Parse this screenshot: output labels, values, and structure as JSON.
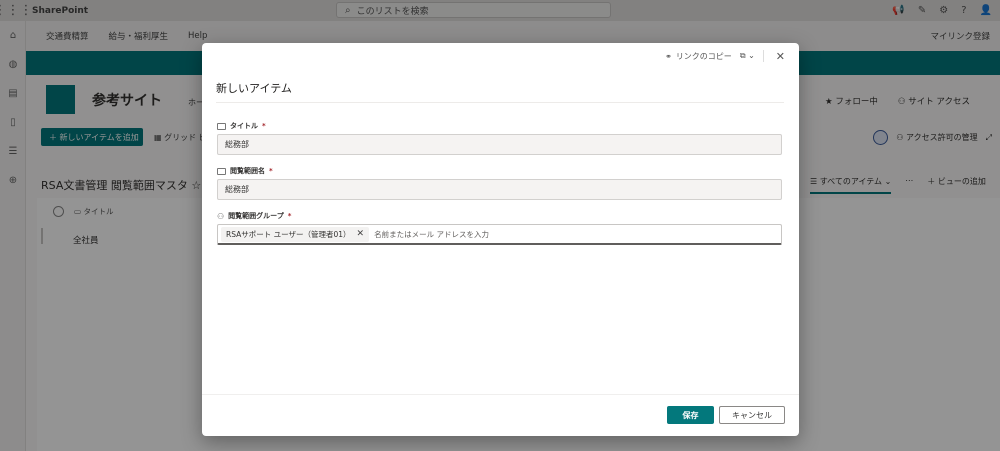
{
  "suitebar": {
    "app_name": "SharePoint",
    "search_placeholder": "このリストを検索"
  },
  "hubnav": {
    "items": [
      "交通費精算",
      "給与・福利厚生",
      "Help"
    ],
    "right_link": "マイリンク登録"
  },
  "site": {
    "title": "参考サイト",
    "nav_fragment": "ホー",
    "follow": "フォロー中",
    "site_access": "サイト アクセス"
  },
  "commandbar": {
    "new_item": "新しいアイテムを追加",
    "grid_edit": "グリッド ビ",
    "access_manage": "アクセス許可の管理"
  },
  "list": {
    "title": "RSA文書管理 閲覧範囲マスタ",
    "column_title": "タイトル",
    "rows": [
      "全社員"
    ],
    "view_name": "すべてのアイテム",
    "add_view": "ビューの追加"
  },
  "dialog": {
    "copy_link": "リンクのコピー",
    "title": "新しいアイテム",
    "fields": [
      {
        "label": "タイトル",
        "required": "*",
        "value": "総務部"
      },
      {
        "label": "閲覧範囲名",
        "required": "*",
        "value": "総務部"
      },
      {
        "label": "閲覧範囲グループ",
        "required": "*",
        "people": "RSAサポート ユーザー（管理者01）",
        "placeholder": "名前またはメール アドレスを入力"
      }
    ],
    "save": "保存",
    "cancel": "キャンセル"
  },
  "colors": {
    "accent": "#03787c"
  }
}
